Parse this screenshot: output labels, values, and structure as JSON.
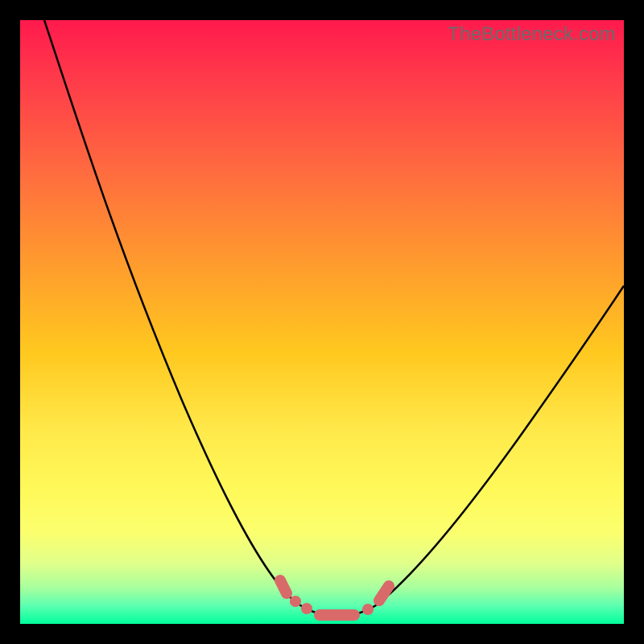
{
  "watermark": "TheBottleneck.com",
  "colors": {
    "background_top": "#ff1a4d",
    "background_bottom": "#00ff9c",
    "marker": "#d96a6a",
    "curve": "#000000",
    "frame_border": "#000000"
  },
  "chart_data": {
    "type": "line",
    "title": "",
    "xlabel": "",
    "ylabel": "",
    "xlim": [
      0,
      100
    ],
    "ylim": [
      0,
      100
    ],
    "grid": false,
    "legend": false,
    "series": [
      {
        "name": "bottleneck-curve",
        "x": [
          0,
          5,
          10,
          15,
          20,
          25,
          30,
          35,
          40,
          43,
          47,
          50,
          54,
          58,
          62,
          68,
          75,
          82,
          90,
          100
        ],
        "y": [
          100,
          89,
          78,
          67,
          56,
          45,
          34,
          23,
          12,
          6,
          2,
          0,
          0,
          2,
          6,
          12,
          20,
          28,
          37,
          47
        ]
      }
    ],
    "markers": [
      {
        "x": 43.5,
        "y": 5.5,
        "shape": "short-bar"
      },
      {
        "x": 45.5,
        "y": 3.5,
        "shape": "dot"
      },
      {
        "x": 47.5,
        "y": 2.0,
        "shape": "dot"
      },
      {
        "x": 52.0,
        "y": 0.5,
        "shape": "long-bar"
      },
      {
        "x": 57.0,
        "y": 1.5,
        "shape": "dot"
      },
      {
        "x": 60.0,
        "y": 4.5,
        "shape": "short-bar"
      }
    ],
    "annotations": []
  }
}
